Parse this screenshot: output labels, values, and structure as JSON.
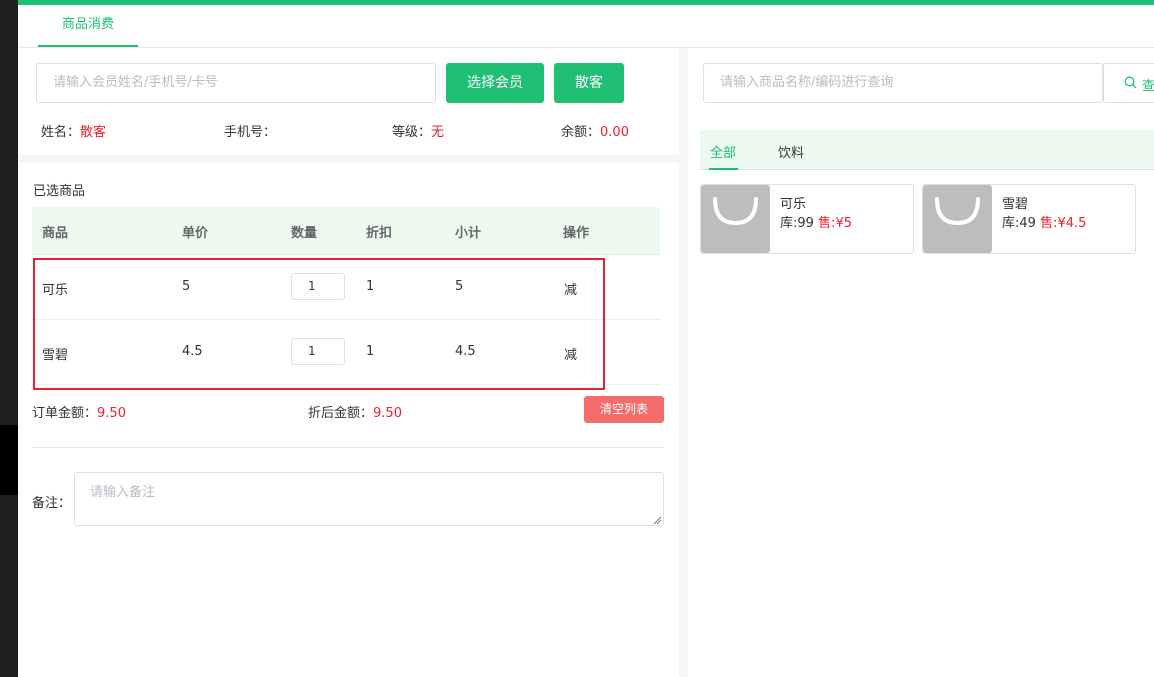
{
  "tabs": [
    {
      "label": "商品消费"
    }
  ],
  "member": {
    "search_placeholder": "请输入会员姓名/手机号/卡号",
    "select_button": "选择会员",
    "guest_button": "散客",
    "name_label": "姓名：",
    "name_value": "散客",
    "phone_label": "手机号：",
    "phone_value": "",
    "level_label": "等级：",
    "level_value": "无",
    "balance_label": "余额：",
    "balance_value": "0.00"
  },
  "selected": {
    "title": "已选商品",
    "columns": [
      "商品",
      "单价",
      "数量",
      "折扣",
      "小计",
      "操作"
    ],
    "rows": [
      {
        "name": "可乐",
        "price": "5",
        "qty": "1",
        "discount": "1",
        "subtotal": "5",
        "action": "减"
      },
      {
        "name": "雪碧",
        "price": "4.5",
        "qty": "1",
        "discount": "1",
        "subtotal": "4.5",
        "action": "减"
      }
    ],
    "order_label": "订单金额：",
    "order_value": "9.50",
    "after_label": "折后金额：",
    "after_value": "9.50",
    "clear_button": "清空列表",
    "remark_label": "备注：",
    "remark_placeholder": "请输入备注"
  },
  "products": {
    "search_placeholder": "请输入商品名称/编码进行查询",
    "search_button": "查",
    "categories": [
      {
        "label": "全部"
      },
      {
        "label": "饮料"
      }
    ],
    "items": [
      {
        "name": "可乐",
        "stock_label": "库:",
        "stock": "99",
        "sale_label": "售:",
        "price": "¥5"
      },
      {
        "name": "雪碧",
        "stock_label": "库:",
        "stock": "49",
        "sale_label": "售:",
        "price": "¥4.5"
      }
    ]
  },
  "colors": {
    "accent": "#1fbf74",
    "danger": "#e8212e",
    "clear_button": "#f56c6c",
    "highlight_box": "#e8212e"
  },
  "icons": {
    "product_placeholder": "shopping-bag-icon",
    "search": "search-icon"
  }
}
